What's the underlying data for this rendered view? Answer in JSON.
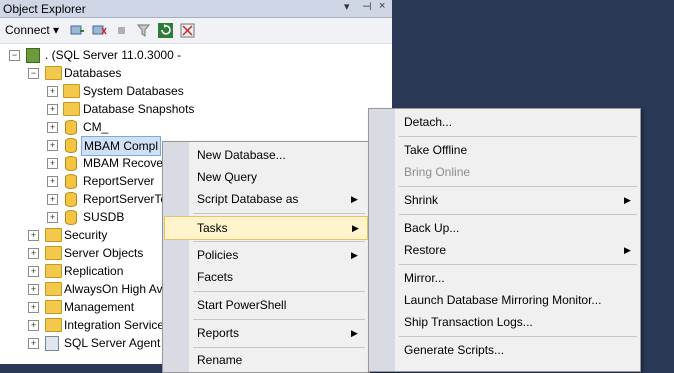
{
  "panel": {
    "title": "Object Explorer",
    "title_controls": [
      "▾",
      "⊣",
      "×"
    ],
    "connect_label": "Connect ▾",
    "toolbar_icons": [
      "connect-icon",
      "disconnect-icon",
      "stop-icon",
      "filter-icon",
      "refresh-icon",
      "activity-icon"
    ]
  },
  "tree": {
    "server": ". (SQL Server 11.0.3000 - ",
    "databases": "Databases",
    "system_databases": "System Databases",
    "database_snapshots": "Database Snapshots",
    "db_cm": "CM_",
    "db_mbam_comp": "MBAM Compl",
    "db_mbam_recovery": "MBAM Recove",
    "db_reportserver": "ReportServer",
    "db_reportservertemp": "ReportServerTe",
    "db_susdb": "SUSDB",
    "security": "Security",
    "server_objects": "Server Objects",
    "replication": "Replication",
    "alwayson": "AlwaysOn High Av",
    "management": "Management",
    "integration_services": "Integration Service",
    "sql_agent": "SQL Server Agent"
  },
  "context_menu": {
    "new_database": "New Database...",
    "new_query": "New Query",
    "script_database_as": "Script Database as",
    "tasks": "Tasks",
    "policies": "Policies",
    "facets": "Facets",
    "start_powershell": "Start PowerShell",
    "reports": "Reports",
    "rename": "Rename"
  },
  "tasks_menu": {
    "detach": "Detach...",
    "take_offline": "Take Offline",
    "bring_online": "Bring Online",
    "shrink": "Shrink",
    "back_up": "Back Up...",
    "restore": "Restore",
    "mirror": "Mirror...",
    "launch_mirroring_monitor": "Launch Database Mirroring Monitor...",
    "ship_transaction_logs": "Ship Transaction Logs...",
    "generate_scripts": "Generate Scripts..."
  },
  "colors": {
    "background": "#293955",
    "highlight": "#fff4cc",
    "selection": "#cfe0f5"
  }
}
